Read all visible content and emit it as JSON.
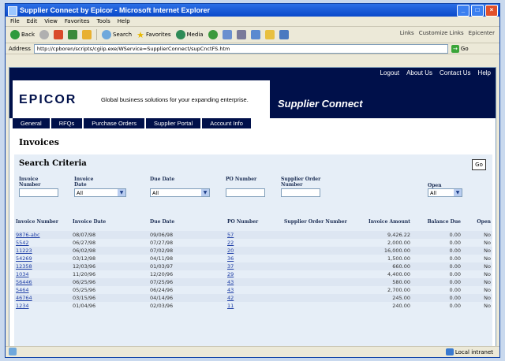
{
  "window": {
    "title": "Supplier Connect by Epicor - Microsoft Internet Explorer"
  },
  "menu": [
    "File",
    "Edit",
    "View",
    "Favorites",
    "Tools",
    "Help"
  ],
  "toolbar": {
    "back": "Back",
    "search": "Search",
    "favorites": "Favorites",
    "media": "Media"
  },
  "links": {
    "label": "Links",
    "items": [
      "Customize Links",
      "Epicenter"
    ]
  },
  "address": {
    "label": "Address",
    "url": "http://cpboren/scripts/cgiip.exe/WService=SupplierConnect/supCnctFS.htm",
    "go": "Go"
  },
  "topnav": [
    "Logout",
    "About Us",
    "Contact Us",
    "Help"
  ],
  "banner": {
    "logo": "EPICOR",
    "tagline": "Global business solutions for your expanding enterprise.",
    "app_title": "Supplier Connect"
  },
  "tabs": [
    "General",
    "RFQs",
    "Purchase Orders",
    "Supplier Portal",
    "Account Info"
  ],
  "page_title": "Invoices",
  "search": {
    "title": "Search Criteria",
    "go": "Go",
    "labels": {
      "invoice_number": "Invoice Number",
      "invoice_date": "Invoice Date",
      "due_date": "Due Date",
      "po_number": "PO Number",
      "supplier_order": "Supplier Order Number",
      "open": "Open"
    },
    "invoice_date_value": "All",
    "due_date_value": "All",
    "open_value": "All"
  },
  "table": {
    "headers": [
      "Invoice Number",
      "Invoice Date",
      "Due Date",
      "PO Number",
      "Supplier Order Number",
      "Invoice Amount",
      "Balance Due",
      "Open"
    ],
    "rows": [
      [
        "9876-abc",
        "08/07/98",
        "09/06/98",
        "57",
        "",
        "9,426.22",
        "0.00",
        "No"
      ],
      [
        "5542",
        "06/27/98",
        "07/27/98",
        "22",
        "",
        "2,000.00",
        "0.00",
        "No"
      ],
      [
        "11223",
        "06/02/98",
        "07/02/98",
        "20",
        "",
        "16,000.00",
        "0.00",
        "No"
      ],
      [
        "54269",
        "03/12/98",
        "04/11/98",
        "36",
        "",
        "1,500.00",
        "0.00",
        "No"
      ],
      [
        "12358",
        "12/03/96",
        "01/03/97",
        "37",
        "",
        "660.00",
        "0.00",
        "No"
      ],
      [
        "1034",
        "11/20/96",
        "12/20/96",
        "29",
        "",
        "4,400.00",
        "0.00",
        "No"
      ],
      [
        "56446",
        "06/25/96",
        "07/25/96",
        "43",
        "",
        "580.00",
        "0.00",
        "No"
      ],
      [
        "5464",
        "05/25/96",
        "06/24/96",
        "43",
        "",
        "2,700.00",
        "0.00",
        "No"
      ],
      [
        "46764",
        "03/15/96",
        "04/14/96",
        "42",
        "",
        "245.00",
        "0.00",
        "No"
      ],
      [
        "1234",
        "01/04/96",
        "02/03/96",
        "11",
        "",
        "240.00",
        "0.00",
        "No"
      ]
    ]
  },
  "status": {
    "zone": "Local intranet"
  }
}
